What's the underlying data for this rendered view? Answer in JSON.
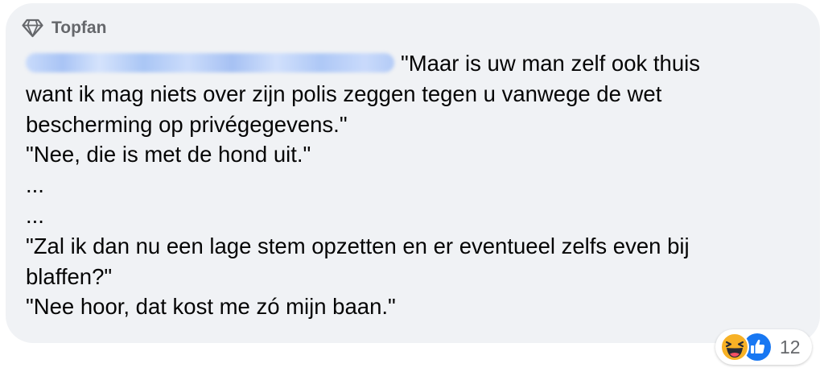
{
  "badge": {
    "label": "Topfan",
    "icon": "diamond-icon"
  },
  "comment": {
    "author_redacted": true,
    "lines": [
      "\"Maar is uw man zelf ook thuis",
      "want ik mag niets over zijn polis zeggen tegen u vanwege de wet",
      "bescherming op privégegevens.\"",
      "\"Nee, die is met de hond uit.\"",
      "...",
      "...",
      "\"Zal ik dan nu een lage stem opzetten en er eventueel zelfs even bij",
      "blaffen?\"",
      "\"Nee hoor, dat kost me zó mijn baan.\""
    ]
  },
  "reactions": {
    "types": [
      "haha-icon",
      "like-icon"
    ],
    "count": "12"
  },
  "colors": {
    "bubble": "#f0f2f5",
    "text": "#050505",
    "secondary_text": "#65676b",
    "like_blue": "#1877f2",
    "haha_yellow": "#f7b125"
  }
}
